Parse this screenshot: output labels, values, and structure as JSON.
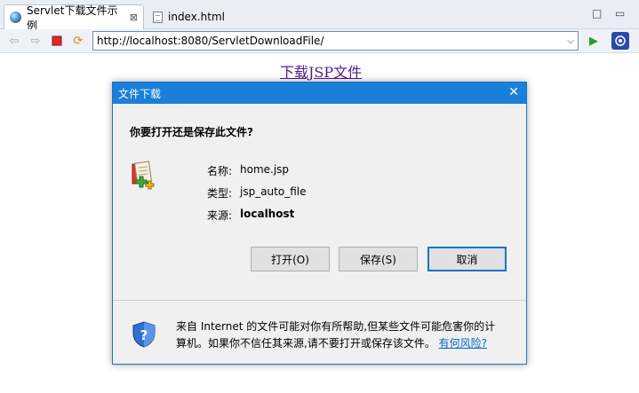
{
  "tabs": [
    {
      "label": "Servlet下载文件示例",
      "close": "⊠"
    },
    {
      "label": "index.html"
    }
  ],
  "window_controls": {
    "minimize": "□",
    "maximize": "▭"
  },
  "toolbar": {
    "url": "http://localhost:8080/ServletDownloadFile/",
    "dropdown": "⌵"
  },
  "page": {
    "link": "下载JSP文件"
  },
  "dialog": {
    "title": "文件下载",
    "close": "✕",
    "question": "你要打开还是保存此文件?",
    "fields": [
      {
        "label": "名称:",
        "value": "home.jsp"
      },
      {
        "label": "类型:",
        "value": "jsp_auto_file"
      },
      {
        "label": "来源:",
        "value": "localhost"
      }
    ],
    "buttons": {
      "open": "打开(O)",
      "save": "保存(S)",
      "cancel": "取消"
    },
    "warning_line1": "来自 Internet 的文件可能对你有所帮助,但某些文件可能危害你的计",
    "warning_line2": "算机。如果你不信任其来源,请不要打开或保存该文件。",
    "risk_link": "有何风险?"
  },
  "colors": {
    "accent": "#1a7fd8",
    "visited_link": "#551a8b",
    "link": "#0066cc"
  }
}
